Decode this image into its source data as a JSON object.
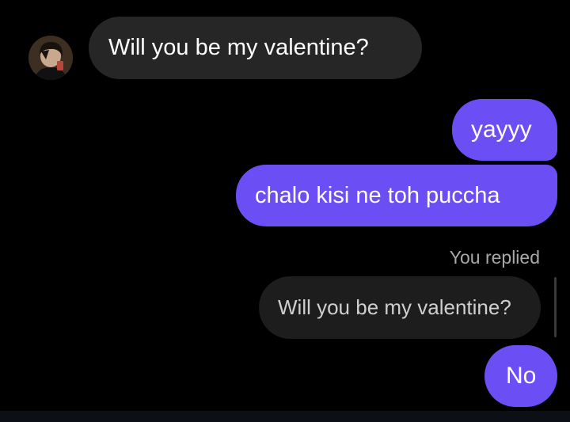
{
  "thread": {
    "avatar_icon": "profile-avatar",
    "messages": {
      "received": "Will you be my valentine?",
      "sent_1": "yayyy",
      "sent_2": "chalo kisi ne toh puccha",
      "reply_label": "You replied",
      "quoted": "Will you be my valentine?",
      "sent_3": "No"
    }
  },
  "colors": {
    "background": "#000000",
    "received_bubble": "#262626",
    "sent_bubble": "#6c4ef5",
    "quoted_bubble": "#1d1d1d",
    "reply_label": "#a8a8a8"
  }
}
